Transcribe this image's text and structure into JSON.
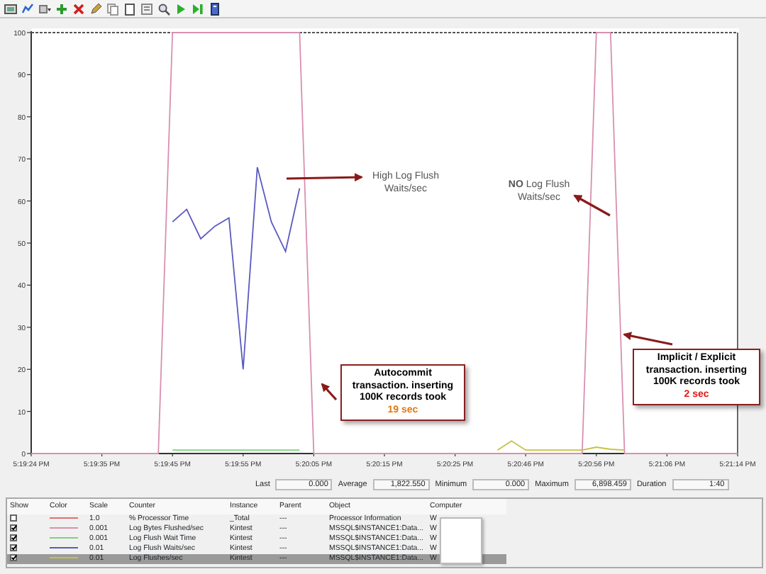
{
  "toolbar": {
    "buttons": [
      {
        "kind": "view"
      },
      {
        "kind": "chart"
      },
      {
        "kind": "dropdown"
      },
      {
        "kind": "add"
      },
      {
        "kind": "delete"
      },
      {
        "kind": "edit"
      },
      {
        "kind": "copy"
      },
      {
        "kind": "paste"
      },
      {
        "kind": "properties"
      },
      {
        "kind": "zoom"
      },
      {
        "kind": "play"
      },
      {
        "kind": "step"
      },
      {
        "kind": "help"
      }
    ]
  },
  "chart": {
    "chart_data": {
      "type": "line",
      "categories": [
        "5:19:24 PM",
        null,
        null,
        null,
        null,
        "5:19:35 PM",
        null,
        null,
        null,
        null,
        "5:19:45 PM",
        null,
        null,
        null,
        null,
        "5:19:55 PM",
        null,
        null,
        null,
        null,
        "5:20:05 PM",
        null,
        null,
        null,
        null,
        "5:20:15 PM",
        null,
        null,
        null,
        null,
        "5:20:25 PM",
        null,
        null,
        null,
        null,
        "5:20:46 PM",
        null,
        null,
        null,
        null,
        "5:20:56 PM",
        null,
        null,
        null,
        null,
        "5:21:06 PM",
        null,
        null,
        null,
        null,
        "5:21:14 PM"
      ],
      "ylim": [
        0,
        100
      ],
      "yticks": [
        0,
        10,
        20,
        30,
        40,
        50,
        60,
        70,
        80,
        90,
        100
      ],
      "series": [
        {
          "color": "#d890b0",
          "values": [
            0,
            0,
            0,
            0,
            0,
            0,
            0,
            0,
            0,
            0,
            100,
            100,
            100,
            100,
            100,
            100,
            100,
            100,
            100,
            100,
            0,
            0,
            0,
            0,
            0,
            0,
            0,
            0,
            0,
            0,
            0,
            0,
            0,
            0,
            0,
            0,
            0,
            0,
            0,
            0,
            100,
            100,
            0,
            0,
            0,
            0,
            0,
            0,
            0,
            0,
            0
          ]
        },
        {
          "color": "#5a5ac0",
          "values": [
            null,
            null,
            null,
            null,
            null,
            null,
            null,
            null,
            null,
            null,
            55,
            58,
            51,
            54,
            56,
            20,
            68,
            55,
            48,
            63,
            null,
            null,
            null,
            null,
            null,
            null,
            null,
            null,
            null,
            null,
            null,
            null,
            null,
            null,
            null,
            null,
            null,
            null,
            null,
            null,
            null,
            null,
            null,
            null,
            null,
            null,
            null,
            null,
            null,
            null,
            null
          ]
        },
        {
          "color": "#c8c040",
          "values": [
            null,
            null,
            null,
            null,
            null,
            null,
            null,
            null,
            null,
            null,
            null,
            null,
            null,
            null,
            null,
            null,
            null,
            null,
            null,
            null,
            null,
            null,
            null,
            null,
            null,
            null,
            null,
            null,
            null,
            null,
            null,
            null,
            null,
            0.8,
            3,
            0.8,
            null,
            null,
            null,
            0.8,
            1.5,
            1,
            0.8,
            null,
            null,
            null,
            null,
            null,
            null,
            null,
            null
          ]
        },
        {
          "color": "#80d080",
          "values": [
            null,
            null,
            null,
            null,
            null,
            null,
            null,
            null,
            null,
            null,
            0.8,
            0.8,
            0.8,
            0.8,
            0.8,
            0.8,
            0.8,
            0.8,
            0.8,
            0.8,
            null,
            null,
            null,
            null,
            null,
            null,
            null,
            null,
            null,
            null,
            null,
            null,
            null,
            null,
            null,
            null,
            null,
            null,
            null,
            null,
            null,
            null,
            null,
            null,
            null,
            null,
            null,
            null,
            null,
            null,
            null
          ]
        }
      ]
    },
    "notes": [
      {
        "kind": "note",
        "text": "High Log Flush Waits/sec"
      },
      {
        "kind": "note",
        "text": "**NO** Log Flush Waits/sec"
      },
      {
        "kind": "callout",
        "text": "Autocommit transaction. inserting 100K records took",
        "highlight": "19 sec",
        "color": "#e07a10"
      },
      {
        "kind": "callout",
        "text": "Implicit / Explicit transaction. inserting 100K records took",
        "highlight": "2 sec",
        "color": "#e01818"
      }
    ]
  },
  "stats": [
    {
      "label": "Last",
      "value": "0.000"
    },
    {
      "label": "Average",
      "value": "1,822.550"
    },
    {
      "label": "Minimum",
      "value": "0.000"
    },
    {
      "label": "Maximum",
      "value": "6,898.459"
    },
    {
      "label": "Duration",
      "value": "1:40"
    }
  ],
  "table": {
    "columns": [
      "Show",
      "Color",
      "Scale",
      "Counter",
      "Instance",
      "Parent",
      "Object",
      "Computer"
    ],
    "rows": [
      {
        "checked": false,
        "selected": false,
        "color": "#e07070",
        "scale": "1.0",
        "counter": "% Processor Time",
        "instance": "_Total",
        "parent": "---",
        "object": "Processor Information",
        "computer": "W"
      },
      {
        "checked": true,
        "selected": false,
        "color": "#d890b0",
        "scale": "0.001",
        "counter": "Log Bytes Flushed/sec",
        "instance": "Kintest",
        "parent": "---",
        "object": "MSSQL$INSTANCE1:Data...",
        "computer": "W"
      },
      {
        "checked": true,
        "selected": false,
        "color": "#80d080",
        "scale": "0.001",
        "counter": "Log Flush Wait Time",
        "instance": "Kintest",
        "parent": "---",
        "object": "MSSQL$INSTANCE1:Data...",
        "computer": "W"
      },
      {
        "checked": true,
        "selected": false,
        "color": "#5a5ac0",
        "scale": "0.01",
        "counter": "Log Flush Waits/sec",
        "instance": "Kintest",
        "parent": "---",
        "object": "MSSQL$INSTANCE1:Data...",
        "computer": "W"
      },
      {
        "checked": true,
        "selected": true,
        "color": "#c8c040",
        "scale": "0.01",
        "counter": "Log Flushes/sec",
        "instance": "Kintest",
        "parent": "---",
        "object": "MSSQL$INSTANCE1:Data...",
        "computer": "W"
      }
    ]
  }
}
